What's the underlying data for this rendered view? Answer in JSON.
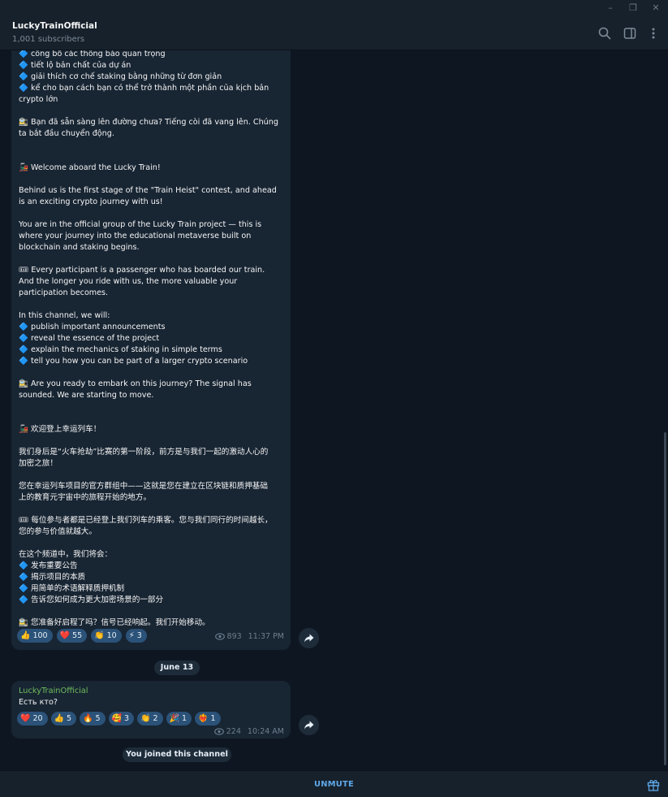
{
  "window": {
    "minimize_icon": "–",
    "restore_icon": "❐",
    "close_icon": "✕"
  },
  "header": {
    "title": "LuckyTrainOfficial",
    "subtitle": "1,001 subscribers"
  },
  "post1": {
    "text": "🔷 công bố các thông báo quan trọng\n🔷 tiết lộ bản chất của dự án\n🔷 giải thích cơ chế staking bằng những từ đơn giản\n🔷 kể cho bạn cách bạn có thể trở thành một phần của kịch bản\ncrypto lớn\n\n🚉 Bạn đã sẵn sàng lên đường chưa? Tiếng còi đã vang lên. Chúng\nta bắt đầu chuyển động.\n\n\n🚂 Welcome aboard the Lucky Train!\n\nBehind us is the first stage of the \"Train Heist\" contest, and ahead\nis an exciting crypto journey with us!\n\nYou are in the official group of the Lucky Train project — this is\nwhere your journey into the educational metaverse built on\nblockchain and staking begins.\n\n🎟 Every participant is a passenger who has boarded our train.\nAnd the longer you ride with us, the more valuable your\nparticipation becomes.\n\nIn this channel, we will:\n🔷 publish important announcements\n🔷 reveal the essence of the project\n🔷 explain the mechanics of staking in simple terms\n🔷 tell you how you can be part of a larger crypto scenario\n\n🚉 Are you ready to embark on this journey? The signal has\nsounded. We are starting to move.\n\n\n🚂 欢迎登上幸运列车！\n\n我们身后是“火车抢劫”比赛的第一阶段，前方是与我们一起的激动人心的\n加密之旅！\n\n您在幸运列车项目的官方群组中——这就是您在建立在区块链和质押基础\n上的教育元宇宙中的旅程开始的地方。\n\n🎟 每位参与者都是已经登上我们列车的乘客。您与我们同行的时间越长，\n您的参与价值就越大。\n\n在这个频道中，我们将会：\n🔷 发布重要公告\n🔷 揭示项目的本质\n🔷 用简单的术语解释质押机制\n🔷 告诉您如何成为更大加密场景的一部分\n\n🚉 您准备好启程了吗？信号已经响起。我们开始移动。",
    "reactions": [
      {
        "emoji": "👍",
        "count": "100"
      },
      {
        "emoji": "❤️",
        "count": "55"
      },
      {
        "emoji": "👏",
        "count": "10"
      },
      {
        "emoji": "⚡",
        "count": "3"
      }
    ],
    "views": "893",
    "time": "11:37 PM"
  },
  "date_separator": "June 13",
  "post2": {
    "sender": "LuckyTrainOfficial",
    "text": "Есть кто?",
    "reactions": [
      {
        "emoji": "❤️",
        "count": "20"
      },
      {
        "emoji": "👍",
        "count": "5"
      },
      {
        "emoji": "🔥",
        "count": "5"
      },
      {
        "emoji": "🥰",
        "count": "3"
      },
      {
        "emoji": "👏",
        "count": "2"
      },
      {
        "emoji": "🎉",
        "count": "1"
      },
      {
        "emoji": "❤️‍🔥",
        "count": "1"
      }
    ],
    "views": "224",
    "time": "10:24 AM"
  },
  "service_message": "You joined this channel",
  "bottom": {
    "unmute_label": "UNMUTE"
  },
  "colors": {
    "background": "#0e1621",
    "bubble": "#182533",
    "header": "#17212b",
    "accent": "#5fa8e8",
    "sender": "#6ebd5c",
    "reaction": "#2b5278"
  },
  "icons": {
    "header": [
      "search-icon",
      "sidebar-toggle-icon",
      "more-vertical-icon"
    ],
    "share": "share-arrow-icon",
    "views": "eye-icon",
    "gift": "gift-icon"
  }
}
